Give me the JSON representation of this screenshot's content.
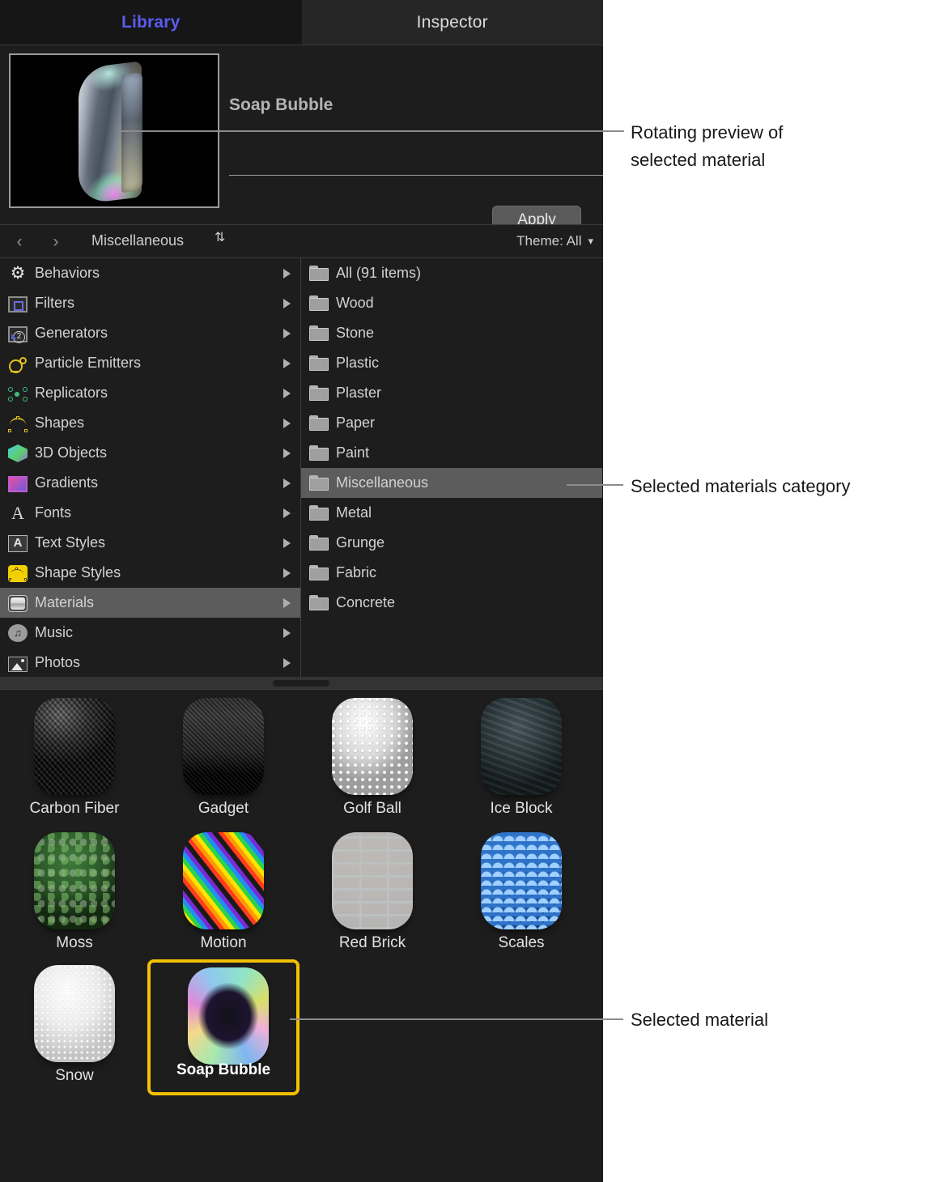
{
  "tabs": [
    {
      "label": "Library",
      "active": true
    },
    {
      "label": "Inspector",
      "active": false
    }
  ],
  "preview": {
    "title": "Soap Bubble",
    "apply_label": "Apply",
    "thumbnail_name": "soap-bubble-3d-preview"
  },
  "navbar": {
    "back_icon": "‹",
    "forward_icon": "›",
    "path": "Miscellaneous",
    "sort_icon": "⇅",
    "theme_label": "Theme: All",
    "theme_chevron": "⌄"
  },
  "sidebar": {
    "items": [
      {
        "label": "Behaviors",
        "icon": "gear-icon",
        "selected": false
      },
      {
        "label": "Filters",
        "icon": "film-strip-icon",
        "selected": false
      },
      {
        "label": "Generators",
        "icon": "generator-icon",
        "selected": false
      },
      {
        "label": "Particle Emitters",
        "icon": "particle-emitter-icon",
        "selected": false
      },
      {
        "label": "Replicators",
        "icon": "replicator-icon",
        "selected": false
      },
      {
        "label": "Shapes",
        "icon": "shape-curve-icon",
        "selected": false
      },
      {
        "label": "3D Objects",
        "icon": "cube-icon",
        "selected": false
      },
      {
        "label": "Gradients",
        "icon": "gradient-swatch-icon",
        "selected": false
      },
      {
        "label": "Fonts",
        "icon": "letter-a-icon",
        "selected": false
      },
      {
        "label": "Text Styles",
        "icon": "text-style-icon",
        "selected": false
      },
      {
        "label": "Shape Styles",
        "icon": "shape-style-icon",
        "selected": false
      },
      {
        "label": "Materials",
        "icon": "material-icon",
        "selected": true
      },
      {
        "label": "Music",
        "icon": "music-note-icon",
        "selected": false
      },
      {
        "label": "Photos",
        "icon": "photo-icon",
        "selected": false
      }
    ]
  },
  "categories": {
    "items": [
      {
        "label": "All (91 items)",
        "selected": false
      },
      {
        "label": "Wood",
        "selected": false
      },
      {
        "label": "Stone",
        "selected": false
      },
      {
        "label": "Plastic",
        "selected": false
      },
      {
        "label": "Plaster",
        "selected": false
      },
      {
        "label": "Paper",
        "selected": false
      },
      {
        "label": "Paint",
        "selected": false
      },
      {
        "label": "Miscellaneous",
        "selected": true
      },
      {
        "label": "Metal",
        "selected": false
      },
      {
        "label": "Grunge",
        "selected": false
      },
      {
        "label": "Fabric",
        "selected": false
      },
      {
        "label": "Concrete",
        "selected": false
      }
    ]
  },
  "grid": {
    "items": [
      {
        "label": "Carbon Fiber",
        "texture": "t-carbon",
        "selected": false
      },
      {
        "label": "Gadget",
        "texture": "t-gadget",
        "selected": false
      },
      {
        "label": "Golf Ball",
        "texture": "t-golf",
        "selected": false
      },
      {
        "label": "Ice Block",
        "texture": "t-ice",
        "selected": false
      },
      {
        "label": "Moss",
        "texture": "t-moss",
        "selected": false
      },
      {
        "label": "Motion",
        "texture": "t-motion",
        "selected": false
      },
      {
        "label": "Red Brick",
        "texture": "t-brick",
        "selected": false
      },
      {
        "label": "Scales",
        "texture": "t-scales",
        "selected": false
      },
      {
        "label": "Snow",
        "texture": "t-snow",
        "selected": false
      },
      {
        "label": "Soap Bubble",
        "texture": "t-soap",
        "selected": true
      }
    ]
  },
  "annotations": [
    {
      "line1": "Rotating preview of",
      "line2": "selected material"
    },
    {
      "line1": "Selected materials category",
      "line2": ""
    },
    {
      "line1": "Selected material",
      "line2": ""
    }
  ],
  "colors": {
    "panel_bg": "#1d1d1d",
    "tab_active_text": "#5b5bf0",
    "selection_gray": "#5c5c5c",
    "selection_yellow": "#f2c000",
    "annotation_text": "#181818",
    "leader_line": "#8c8c8c"
  }
}
